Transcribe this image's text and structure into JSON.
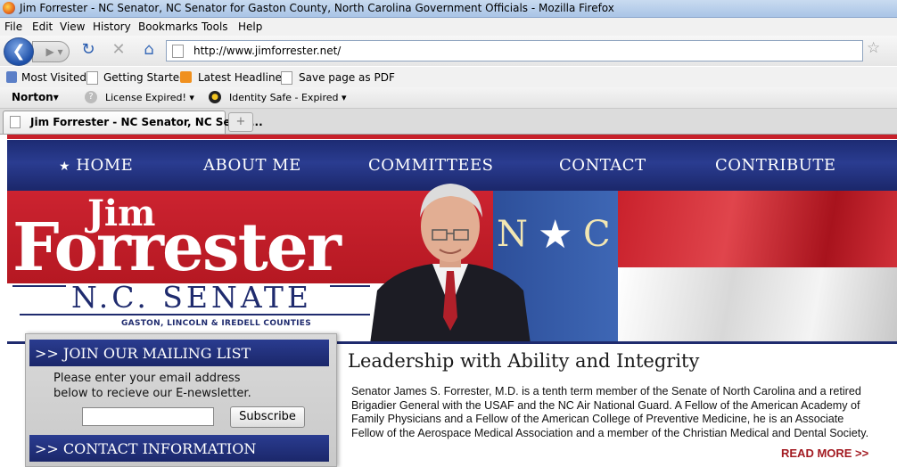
{
  "window": {
    "title": "Jim Forrester - NC Senator, NC Senator for Gaston County, North Carolina Government Officials - Mozilla Firefox"
  },
  "menu": [
    "File",
    "Edit",
    "View",
    "History",
    "Bookmarks",
    "Tools",
    "Help"
  ],
  "nav": {
    "url": "http://www.jimforrester.net/"
  },
  "bookmarks": [
    "Most Visited",
    "Getting Started",
    "Latest Headlines",
    "Save page as PDF"
  ],
  "norton": {
    "brand": "Norton",
    "license": "License Expired!",
    "identity": "Identity Safe - Expired"
  },
  "tabs": [
    {
      "label": "Jim Forrester - NC Senator, NC Senat..."
    }
  ],
  "site": {
    "nav": [
      "HOME",
      "ABOUT ME",
      "COMMITTEES",
      "CONTACT",
      "CONTRIBUTE"
    ],
    "banner": {
      "first_name": "Jim",
      "last_name": "Forrester",
      "office": "N.C. SENATE",
      "counties": "GASTON, LINCOLN & IREDELL COUNTIES",
      "flag_letters": [
        "N",
        "C"
      ]
    },
    "sidebar": {
      "mailing_head": ">> JOIN OUR MAILING LIST",
      "mailing_text_1": "Please enter your email address",
      "mailing_text_2": "below to recieve our E-newsletter.",
      "email_value": "",
      "subscribe": "Subscribe",
      "contact_head": ">> CONTACT INFORMATION"
    },
    "main": {
      "headline": "Leadership with Ability and Integrity",
      "bio_lines": [
        "Senator James S. Forrester, M.D. is a tenth term member of the Senate of North Carolina and a retired",
        "Brigadier General with the USAF and the NC Air National Guard. A Fellow of the American Academy of",
        "Family Physicians and a Fellow of the American College of Preventive Medicine, he is an Associate",
        "Fellow of the Aerospace Medical Association and a member of the Christian Medical and Dental Society."
      ],
      "read_more": "READ MORE >>"
    }
  },
  "colors": {
    "nav_blue": "#1d2b73",
    "banner_red": "#c7202a",
    "read_more": "#a31b22"
  }
}
